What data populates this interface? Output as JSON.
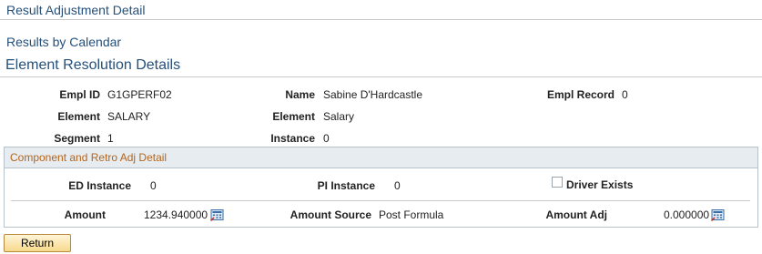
{
  "page": {
    "title": "Result Adjustment Detail",
    "subtitle": "Results by Calendar",
    "section_title": "Element Resolution Details"
  },
  "details": {
    "empl_id_label": "Empl ID",
    "empl_id": "G1GPERF02",
    "name_label": "Name",
    "name": "Sabine D'Hardcastle",
    "empl_record_label": "Empl Record",
    "empl_record": "0",
    "element_label": "Element",
    "element": "SALARY",
    "element2_label": "Element",
    "element_desc": "Salary",
    "segment_label": "Segment",
    "segment": "1",
    "instance_label": "Instance",
    "instance": "0"
  },
  "component": {
    "header": "Component and Retro Adj Detail",
    "ed_instance_label": "ED Instance",
    "ed_instance": "0",
    "pi_instance_label": "PI Instance",
    "pi_instance": "0",
    "driver_exists_label": "Driver Exists",
    "driver_exists_checked": false,
    "amount_label": "Amount",
    "amount": "1234.940000",
    "amount_source_label": "Amount Source",
    "amount_source": "Post Formula",
    "amount_adj_label": "Amount Adj",
    "amount_adj": "0.000000",
    "calculator_icon": "calculator-icon"
  },
  "actions": {
    "return_label": "Return"
  }
}
